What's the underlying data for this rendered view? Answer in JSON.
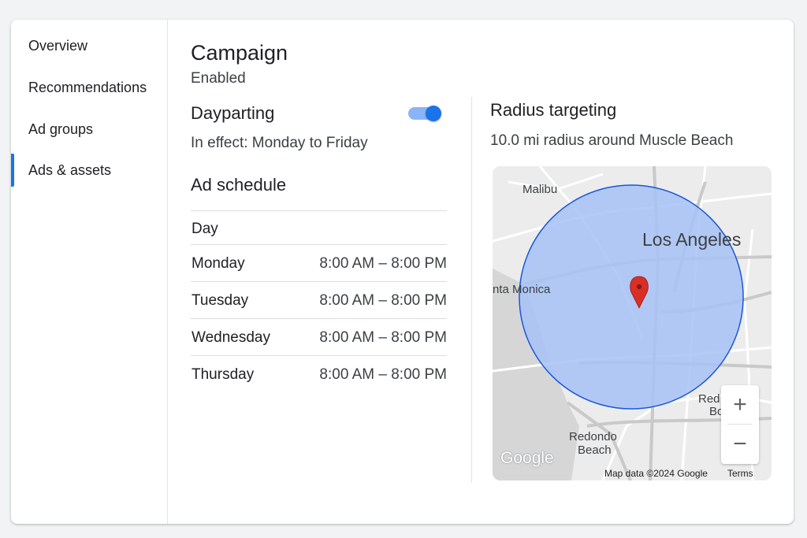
{
  "sidebar": {
    "items": [
      {
        "label": "Overview",
        "active": false
      },
      {
        "label": "Recommendations",
        "active": false
      },
      {
        "label": "Ad groups",
        "active": false
      },
      {
        "label": "Ads & assets",
        "active": true
      }
    ]
  },
  "header": {
    "title": "Campaign",
    "status": "Enabled"
  },
  "dayparting": {
    "title": "Dayparting",
    "toggle_on": true,
    "description": "In effect: Monday to Friday"
  },
  "schedule": {
    "title": "Ad schedule",
    "column_header": "Day",
    "rows": [
      {
        "day": "Monday",
        "time": "8:00 AM – 8:00 PM"
      },
      {
        "day": "Tuesday",
        "time": "8:00 AM – 8:00 PM"
      },
      {
        "day": "Wednesday",
        "time": "8:00 AM – 8:00 PM"
      },
      {
        "day": "Thursday",
        "time": "8:00 AM – 8:00 PM"
      }
    ]
  },
  "radius": {
    "title": "Radius targeting",
    "description": "10.0 mi radius around Muscle Beach"
  },
  "map": {
    "places": {
      "malibu": "Malibu",
      "los_angeles": "Los Angeles",
      "santa_monica": "nta Monica",
      "redondo": "Redondo",
      "redondo_2": "Beach",
      "redlands_1": "Red",
      "redlands_2": "Bo"
    },
    "zoom_in": "+",
    "zoom_out": "−",
    "logo": "Google",
    "attribution": "Map data ©2024 Google",
    "terms": "Terms",
    "colors": {
      "radius_fill": "#a7c2f7",
      "radius_stroke": "#1a57d6",
      "marker": "#d93025",
      "water": "#d5d5d5",
      "land": "#ececec"
    }
  },
  "colors": {
    "accent": "#1a73e8",
    "toggle_track": "#8ab4f8"
  }
}
